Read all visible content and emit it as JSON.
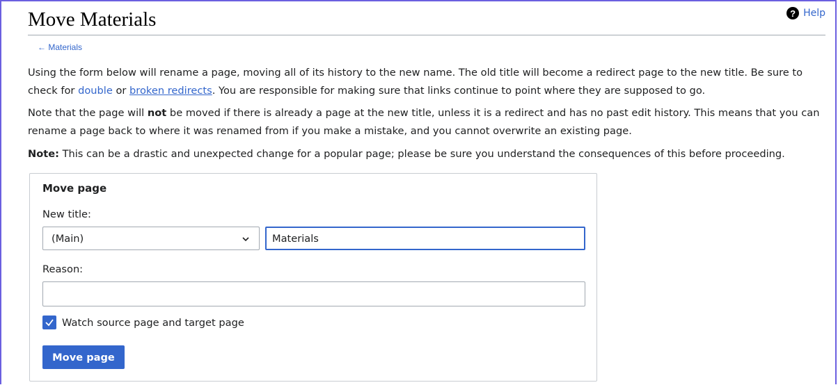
{
  "page": {
    "title": "Move Materials",
    "help_label": "Help",
    "back_link": "← Materials"
  },
  "intro": {
    "p1_before": "Using the form below will rename a page, moving all of its history to the new name. The old title will become a redirect page to the new title. Be sure to check for ",
    "p1_link_double": "double",
    "p1_mid": " or ",
    "p1_link_broken": "broken redirects",
    "p1_after": ". You are responsible for making sure that links continue to point where they are supposed to go.",
    "p2_before": "Note that the page will ",
    "p2_bold": "not",
    "p2_after": " be moved if there is already a page at the new title, unless it is a redirect and has no past edit history. This means that you can rename a page back to where it was renamed from if you make a mistake, and you cannot overwrite an existing page.",
    "p3_bold": "Note:",
    "p3_after": " This can be a drastic and unexpected change for a popular page; please be sure you understand the consequences of this before proceeding."
  },
  "form": {
    "legend": "Move page",
    "new_title_label": "New title:",
    "namespace_value": "(Main)",
    "title_value": "Materials",
    "reason_label": "Reason:",
    "reason_value": "",
    "watch_label": "Watch source page and target page",
    "watch_checked": true,
    "submit_label": "Move page"
  },
  "colors": {
    "accent": "#3366cc",
    "frame": "#6b5fe0"
  }
}
